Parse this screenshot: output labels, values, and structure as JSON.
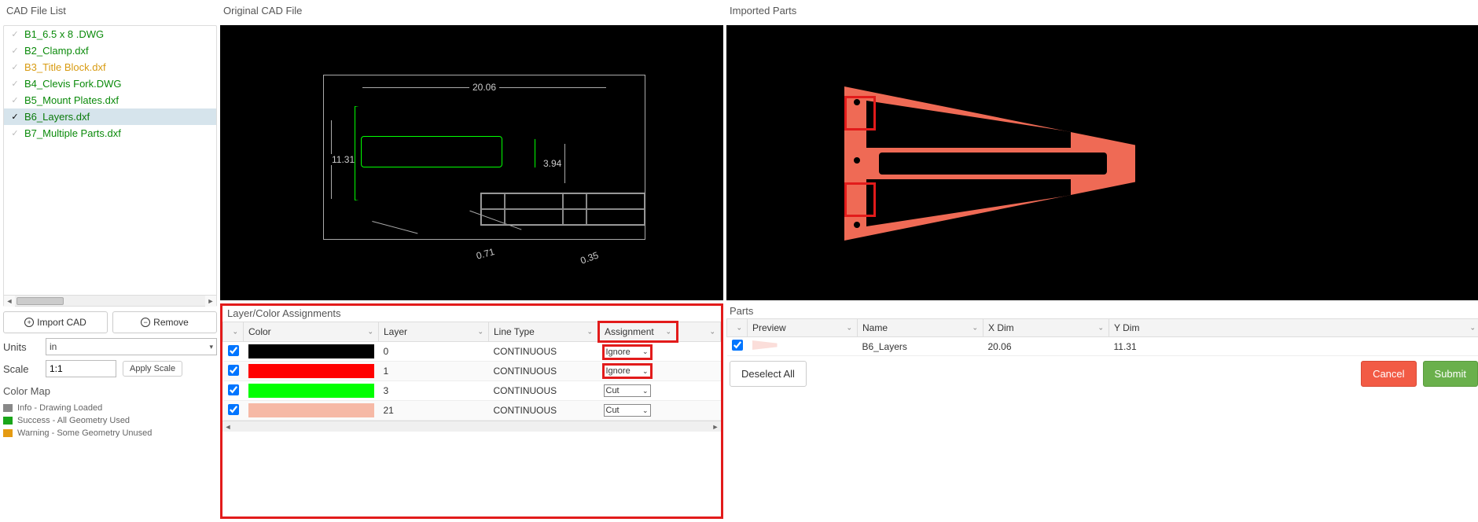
{
  "titles": {
    "fileList": "CAD File List",
    "originalCad": "Original CAD File",
    "importedParts": "Imported Parts",
    "layerPanel": "Layer/Color Assignments",
    "parts": "Parts",
    "colorMap": "Color Map"
  },
  "fileList": {
    "items": [
      {
        "name": "B1_6.5 x 8 .DWG",
        "status": "success",
        "selected": false
      },
      {
        "name": "B2_Clamp.dxf",
        "status": "success",
        "selected": false
      },
      {
        "name": "B3_Title Block.dxf",
        "status": "warning",
        "selected": false
      },
      {
        "name": "B4_Clevis Fork.DWG",
        "status": "success",
        "selected": false
      },
      {
        "name": "B5_Mount Plates.dxf",
        "status": "success",
        "selected": false
      },
      {
        "name": "B6_Layers.dxf",
        "status": "success",
        "selected": true
      },
      {
        "name": "B7_Multiple Parts.dxf",
        "status": "success",
        "selected": false
      }
    ]
  },
  "buttons": {
    "importCad": "Import CAD",
    "remove": "Remove",
    "applyScale": "Apply Scale",
    "deselectAll": "Deselect All",
    "cancel": "Cancel",
    "submit": "Submit"
  },
  "form": {
    "unitsLabel": "Units",
    "unitsValue": "in",
    "scaleLabel": "Scale",
    "scaleValue": "1:1"
  },
  "colorMap": {
    "items": [
      {
        "color": "#888888",
        "label": "Info - Drawing Loaded"
      },
      {
        "color": "#1aa61a",
        "label": "Success - All Geometry Used"
      },
      {
        "color": "#e59b12",
        "label": "Warning - Some Geometry Unused"
      }
    ]
  },
  "cadDims": {
    "width": "20.06",
    "height": "11.31",
    "small": "3.94",
    "dia1": "0.35",
    "dia2": "0.71",
    "diaSym": "⌀"
  },
  "layerTable": {
    "headers": {
      "color": "Color",
      "layer": "Layer",
      "lineType": "Line Type",
      "assignment": "Assignment"
    },
    "rows": [
      {
        "color": "#000000",
        "layer": "0",
        "lineType": "CONTINUOUS",
        "assignment": "Ignore",
        "hlAssign": true
      },
      {
        "color": "#ff0000",
        "layer": "1",
        "lineType": "CONTINUOUS",
        "assignment": "Ignore",
        "hlAssign": true
      },
      {
        "color": "#00ff00",
        "layer": "3",
        "lineType": "CONTINUOUS",
        "assignment": "Cut",
        "hlAssign": false
      },
      {
        "color": "#f6b9a6",
        "layer": "21",
        "lineType": "CONTINUOUS",
        "assignment": "Cut",
        "hlAssign": false
      }
    ]
  },
  "partsTable": {
    "headers": {
      "preview": "Preview",
      "name": "Name",
      "xdim": "X Dim",
      "ydim": "Y Dim"
    },
    "rows": [
      {
        "name": "B6_Layers",
        "xdim": "20.06",
        "ydim": "11.31",
        "checked": true
      }
    ]
  },
  "colors": {
    "partFill": "#ef6a55",
    "highlight": "#e21b1b"
  }
}
